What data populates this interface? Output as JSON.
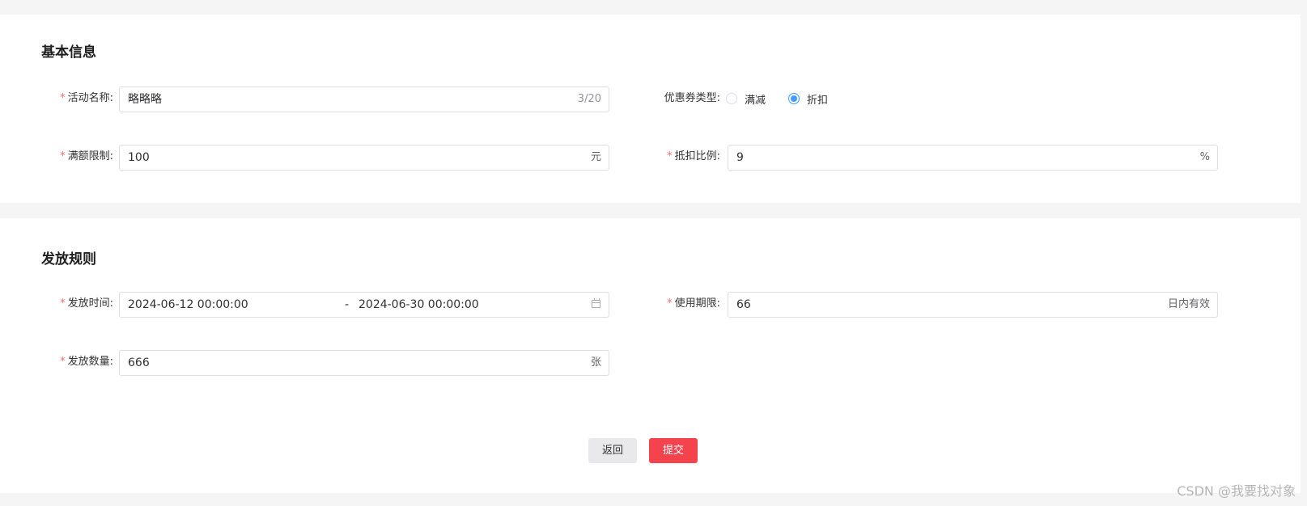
{
  "basic_info": {
    "title": "基本信息",
    "activity_name": {
      "label": "活动名称:",
      "value": "略略略",
      "counter": "3/20"
    },
    "coupon_type": {
      "label": "优惠券类型:",
      "options": [
        {
          "label": "满减",
          "checked": false
        },
        {
          "label": "折扣",
          "checked": true
        }
      ]
    },
    "amount_limit": {
      "label": "满额限制:",
      "value": "100",
      "suffix": "元"
    },
    "discount_ratio": {
      "label": "抵扣比例:",
      "value": "9",
      "suffix": "%"
    }
  },
  "issue_rules": {
    "title": "发放规则",
    "issue_time": {
      "label": "发放时间:",
      "start": "2024-06-12 00:00:00",
      "separator": "-",
      "end": "2024-06-30 00:00:00"
    },
    "validity": {
      "label": "使用期限:",
      "value": "66",
      "suffix": "日内有效"
    },
    "quantity": {
      "label": "发放数量:",
      "value": "666",
      "suffix": "张"
    }
  },
  "actions": {
    "back_label": "返回",
    "submit_label": "提交"
  },
  "watermark": "CSDN @我要找对象",
  "colors": {
    "required": "#f56c6c",
    "radio_checked": "#409eff",
    "submit": "#f5434e",
    "back": "#e9e9eb"
  },
  "icons": [
    "calendar-icon"
  ]
}
